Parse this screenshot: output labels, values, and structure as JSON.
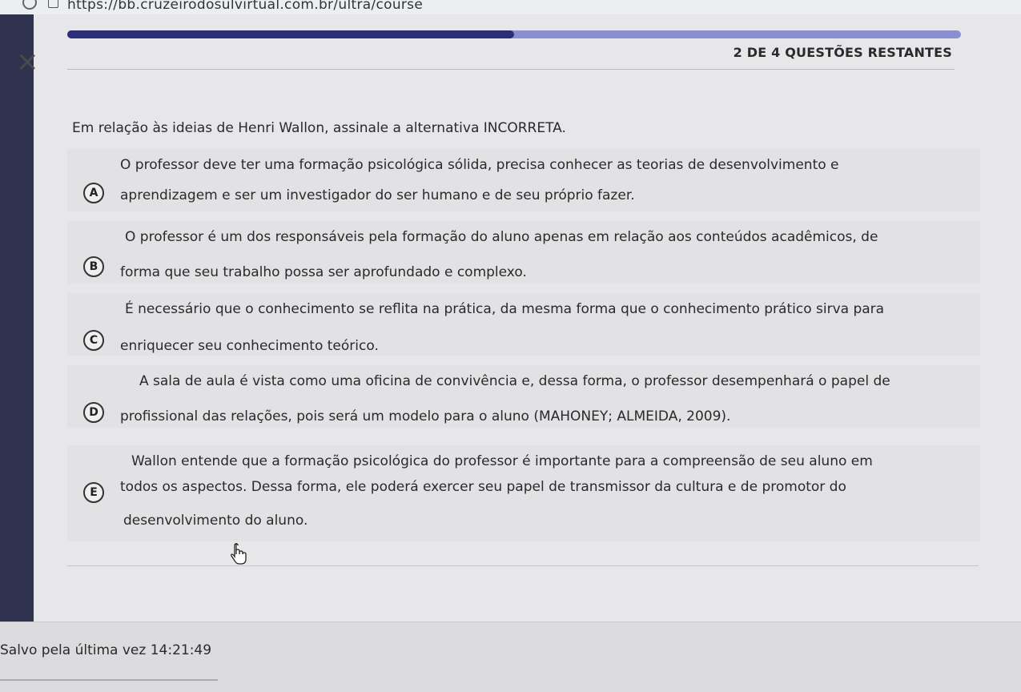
{
  "browser": {
    "url": "https://bb.cruzeirodosulvirtual.com.br/ultra/course"
  },
  "quiz": {
    "progress": 0.5,
    "remaining_label": "2 DE 4 QUESTÕES RESTANTES",
    "close_symbol": "×",
    "question": "Em relação às ideias de Henri Wallon, assinale a alternativa INCORRETA.",
    "options": [
      {
        "letter": "A",
        "line1": "O professor deve ter uma formação psicológica sólida, precisa conhecer as teorias de desenvolvimento e",
        "line2": "aprendizagem e ser um investigador do ser humano e de seu próprio fazer."
      },
      {
        "letter": "B",
        "line1": "O professor é um dos responsáveis pela formação do aluno apenas em relação aos conteúdos acadêmicos, de",
        "line2": "forma que seu trabalho possa ser aprofundado e complexo."
      },
      {
        "letter": "C",
        "line1": "É necessário que o conhecimento se reflita na prática, da mesma forma que o conhecimento prático sirva para",
        "line2": "enriquecer seu conhecimento teórico."
      },
      {
        "letter": "D",
        "line1": "A sala de aula é vista como uma oficina de convivência e, dessa forma, o professor desempenhará o papel de",
        "line2": "profissional das relações, pois será um modelo para o aluno (MAHONEY; ALMEIDA, 2009)."
      },
      {
        "letter": "E",
        "line1": "Wallon entende que a formação psicológica do professor é importante para a compreensão de seu aluno em",
        "line2": "todos os aspectos. Dessa forma, ele poderá exercer seu papel de transmissor da cultura e de promotor do",
        "line3": "desenvolvimento do aluno."
      }
    ],
    "saved_label": "Salvo pela última vez 14:21:49"
  },
  "icons": {
    "close": "close-icon",
    "reload": "reload-icon",
    "lock": "lock-icon",
    "cursor": "hand-pointer-icon"
  },
  "colors": {
    "sidebar": "#2f3350",
    "progress_fill": "#2c2f78",
    "progress_track": "#8b8fd0"
  }
}
